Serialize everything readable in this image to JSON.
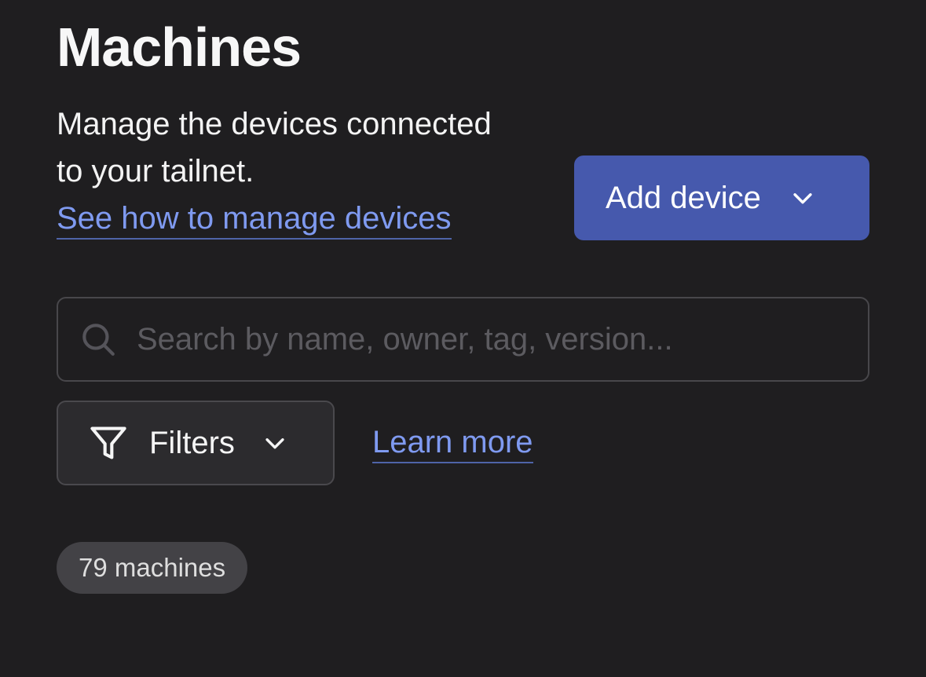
{
  "header": {
    "title": "Machines",
    "description_line1": "Manage the devices connected",
    "description_line2": "to your tailnet.",
    "manage_link": "See how to manage devices"
  },
  "actions": {
    "add_device_label": "Add device",
    "add_device_icon": "chevron-down-icon"
  },
  "search": {
    "placeholder": "Search by name, owner, tag, version...",
    "value": "",
    "icon": "search-icon"
  },
  "filters": {
    "label": "Filters",
    "icon": "filter-icon",
    "learn_more": "Learn more"
  },
  "summary": {
    "count_label": "79 machines"
  },
  "colors": {
    "background": "#1f1e20",
    "accent": "#4659ad",
    "link": "#7f9af0"
  }
}
